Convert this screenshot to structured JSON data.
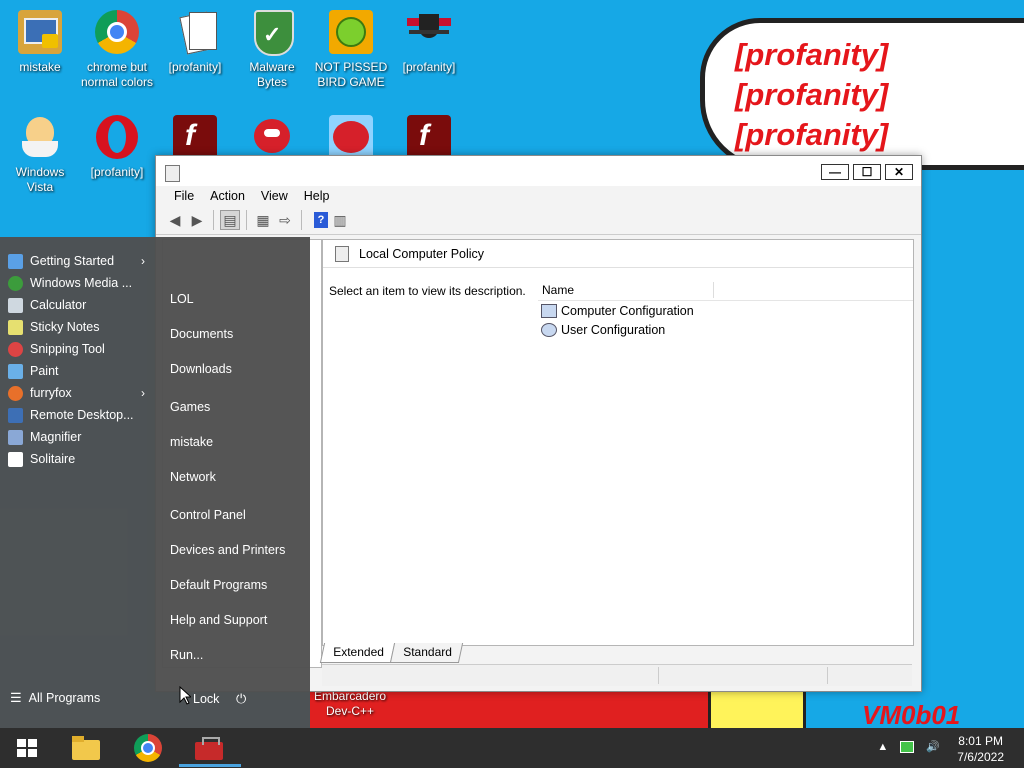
{
  "desktop": {
    "icons": [
      {
        "label": "mistake"
      },
      {
        "label": "chrome but\nnormal colors"
      },
      {
        "label": "[profanity]"
      },
      {
        "label": "Malware\nBytes"
      },
      {
        "label": "NOT PISSED\nBIRD GAME"
      },
      {
        "label": "[profanity]"
      },
      {
        "label": "Windows\nVista"
      },
      {
        "label": "[profanity]"
      },
      {
        "label": "Embarcadero\nDev-C++"
      }
    ],
    "bubble_lines": [
      "[profanity]",
      "[profanity]",
      "[profanity]"
    ],
    "signature": "VM0b01"
  },
  "window": {
    "menu": [
      "File",
      "Action",
      "View",
      "Help"
    ],
    "buttons": {
      "minimize": "—",
      "maximize": "☐",
      "close": "✕"
    },
    "header_title": "Local Computer Policy",
    "description": "Select an item to view its description.",
    "column_name": "Name",
    "items": [
      "Computer Configuration",
      "User Configuration"
    ],
    "tabs": [
      "Extended",
      "Standard"
    ]
  },
  "start_menu": {
    "programs": [
      {
        "label": "Getting Started",
        "arrow": "›"
      },
      {
        "label": "Windows Media ..."
      },
      {
        "label": "Calculator"
      },
      {
        "label": "Sticky Notes"
      },
      {
        "label": "Snipping Tool"
      },
      {
        "label": "Paint"
      },
      {
        "label": "furryfox",
        "arrow": "›"
      },
      {
        "label": "Remote Desktop..."
      },
      {
        "label": "Magnifier"
      },
      {
        "label": "Solitaire"
      }
    ],
    "places": [
      "LOL",
      "Documents",
      "Downloads",
      "Games",
      "mistake",
      "Network",
      "Control Panel",
      "Devices and Printers",
      "Default Programs",
      "Help and Support",
      "Run..."
    ],
    "all_programs": "All Programs",
    "lock": "Lock",
    "power": "⏻"
  },
  "taskbar": {
    "tray_arrow": "▲",
    "volume": "🔊",
    "time": "8:01 PM",
    "date": "7/6/2022"
  }
}
